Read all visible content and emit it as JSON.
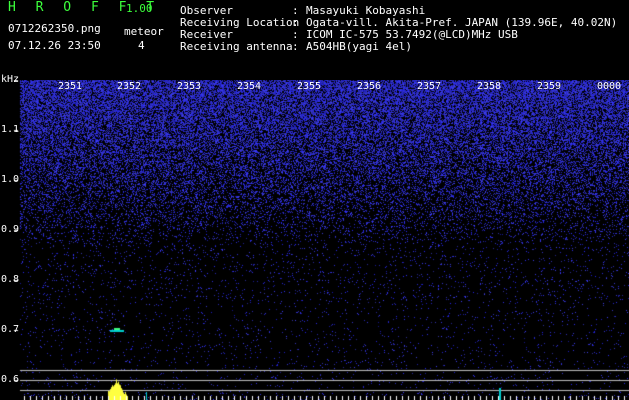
{
  "header": {
    "app_title": "H R O F F T",
    "version": "1.00",
    "filename": "0712262350.png",
    "datetime": "07.12.26 23:50",
    "meteor_label": "meteor",
    "meteor_count": "4",
    "fields": [
      {
        "label": "Observer",
        "sep": ":",
        "value": "Masayuki Kobayashi"
      },
      {
        "label": "Receiving Location",
        "sep": ":",
        "value": "Ogata-vill. Akita-Pref. JAPAN (139.96E, 40.02N)"
      },
      {
        "label": "Receiver",
        "sep": ":",
        "value": "ICOM IC-575 53.7492(@LCD)MHz USB"
      },
      {
        "label": "Receiving antenna",
        "sep": ":",
        "value": "A504HB(yagi 4el)"
      }
    ]
  },
  "waterfall": {
    "y_unit": "kHz",
    "y_ticks": [
      "1.1",
      "1.0",
      "0.9",
      "0.8",
      "0.7",
      "0.6"
    ],
    "x_ticks": [
      "2351",
      "2352",
      "2353",
      "2354",
      "2355",
      "2356",
      "2357",
      "2358",
      "2359",
      "0000"
    ],
    "colors": {
      "noise": "#2a2aff",
      "signal": "#ffff40",
      "line": "#c8c8c8",
      "mark": "#00d0d0"
    }
  }
}
